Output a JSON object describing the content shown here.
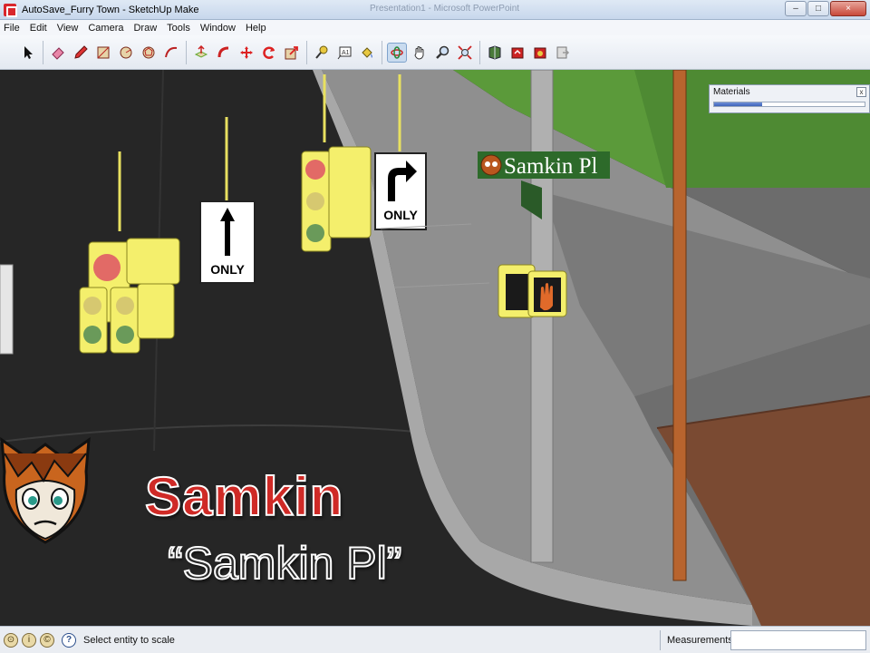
{
  "window": {
    "title": "AutoSave_Furry Town - SketchUp Make",
    "background_title": "Presentation1 - Microsoft PowerPoint",
    "controls": {
      "minimize": "–",
      "maximize": "□",
      "close": "×"
    }
  },
  "menu": [
    "File",
    "Edit",
    "View",
    "Camera",
    "Draw",
    "Tools",
    "Window",
    "Help"
  ],
  "toolbar": {
    "groups": [
      [
        {
          "name": "select-tool",
          "icon": "arrow-icon"
        }
      ],
      [
        {
          "name": "eraser-tool",
          "icon": "eraser-icon"
        },
        {
          "name": "pencil-tool",
          "icon": "pencil-icon"
        },
        {
          "name": "rectangle-tool",
          "icon": "rectangle-icon"
        },
        {
          "name": "circle-tool",
          "icon": "circle-icon"
        },
        {
          "name": "polygon-tool",
          "icon": "polygon-icon"
        },
        {
          "name": "arc-tool",
          "icon": "arc-icon"
        }
      ],
      [
        {
          "name": "push-pull-tool",
          "icon": "push-pull-icon"
        },
        {
          "name": "follow-me-tool",
          "icon": "follow-me-icon"
        },
        {
          "name": "move-tool",
          "icon": "move-icon"
        },
        {
          "name": "rotate-tool",
          "icon": "rotate-icon"
        },
        {
          "name": "scale-tool",
          "icon": "scale-icon"
        }
      ],
      [
        {
          "name": "tape-measure-tool",
          "icon": "tape-measure-icon"
        },
        {
          "name": "text-tool",
          "icon": "text-icon"
        },
        {
          "name": "paint-bucket-tool",
          "icon": "paint-bucket-icon"
        }
      ],
      [
        {
          "name": "orbit-tool",
          "icon": "orbit-icon",
          "active": true
        },
        {
          "name": "pan-tool",
          "icon": "hand-icon"
        },
        {
          "name": "zoom-tool",
          "icon": "zoom-icon"
        },
        {
          "name": "zoom-extents-tool",
          "icon": "zoom-extents-icon"
        }
      ],
      [
        {
          "name": "3d-warehouse-tool",
          "icon": "warehouse-icon"
        },
        {
          "name": "share-model-tool",
          "icon": "share-model-icon"
        },
        {
          "name": "extension-warehouse-tool",
          "icon": "extension-icon"
        },
        {
          "name": "send-layout-tool",
          "icon": "layout-icon"
        }
      ]
    ]
  },
  "materials_panel": {
    "title": "Materials",
    "close": "x",
    "progress": 0.32
  },
  "scene": {
    "signs": {
      "straight_only": "ONLY",
      "right_turn_only": "ONLY",
      "street_name": "Samkin Pl"
    }
  },
  "overlay": {
    "name": "Samkin",
    "quote": "“Samkin Pl”"
  },
  "status": {
    "message": "Select entity to scale",
    "measurements_label": "Measurements",
    "measurements_value": ""
  },
  "colors": {
    "road": "#262626",
    "sidewalk": "#8f8f8f",
    "grass": "#5b9a3a",
    "brick": "#7a4a32",
    "signal_yellow": "#f4ef6c",
    "name_red": "#cf2a26"
  }
}
